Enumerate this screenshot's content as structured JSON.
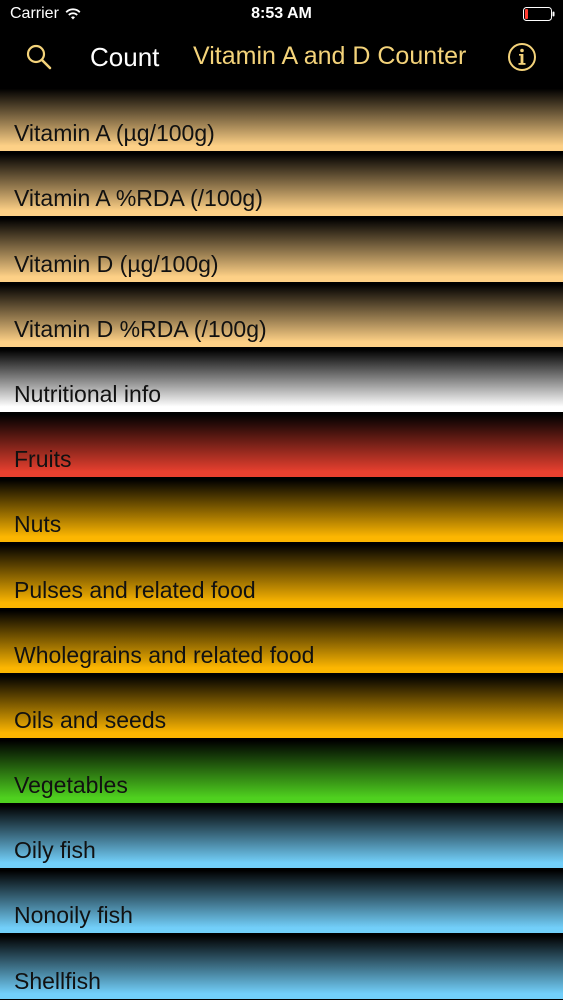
{
  "status_bar": {
    "carrier": "Carrier",
    "time": "8:53 AM"
  },
  "nav": {
    "search_icon": "search-icon",
    "count_label": "Count",
    "title": "Vitamin A and D Counter",
    "info_icon": "info-icon",
    "title_color": "#f4d37a"
  },
  "list": {
    "items": [
      {
        "label": "Vitamin A (µg/100g)",
        "color": "#fdd086"
      },
      {
        "label": "Vitamin A %RDA (/100g)",
        "color": "#fdd086"
      },
      {
        "label": "Vitamin D (µg/100g)",
        "color": "#fdd086"
      },
      {
        "label": "Vitamin D %RDA (/100g)",
        "color": "#fdd086"
      },
      {
        "label": "Nutritional info",
        "color": "#ffffff"
      },
      {
        "label": "Fruits",
        "color": "#e8402f"
      },
      {
        "label": "Nuts",
        "color": "#fcb601"
      },
      {
        "label": "Pulses and related food",
        "color": "#fcb601"
      },
      {
        "label": "Wholegrains and related food",
        "color": "#fcb601"
      },
      {
        "label": "Oils and seeds",
        "color": "#fcb601"
      },
      {
        "label": "Vegetables",
        "color": "#4fd11f"
      },
      {
        "label": "Oily fish",
        "color": "#72cff9"
      },
      {
        "label": "Nonoily fish",
        "color": "#72cff9"
      },
      {
        "label": "Shellfish",
        "color": "#72cff9"
      }
    ]
  }
}
